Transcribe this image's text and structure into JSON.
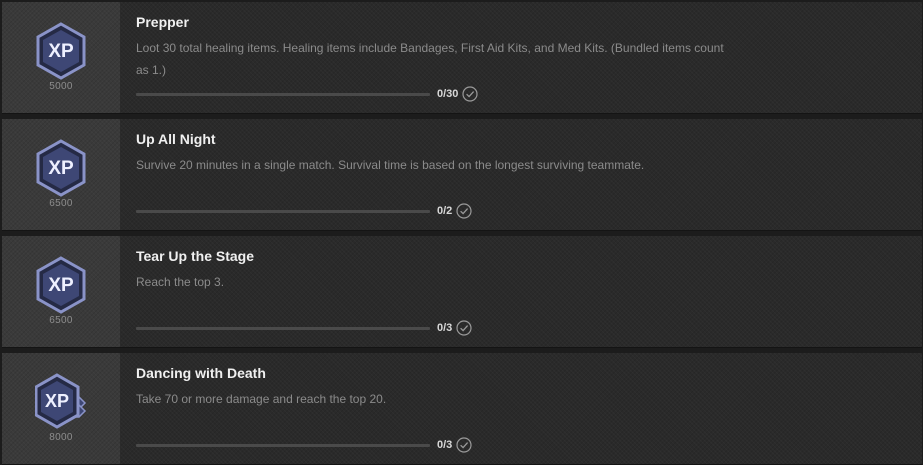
{
  "colors": {
    "badge_fill": "#3e4775",
    "badge_ring": "#8a93c8",
    "badge_text": "#eef0ff",
    "card_bg": "#2a2a2a",
    "reward_bg": "#3a3a3a"
  },
  "challenges": [
    {
      "title": "Prepper",
      "description": "Loot 30 total healing items. Healing items include Bandages, First Aid Kits, and Med Kits. (Bundled items count as 1.)",
      "xp": "5000",
      "progress_text": "0/30",
      "progress_fraction": 0,
      "badge_icon": "xp-badge-icon"
    },
    {
      "title": "Up All Night",
      "description": "Survive 20 minutes in a single match. Survival time is based on the longest surviving teammate.",
      "xp": "6500",
      "progress_text": "0/2",
      "progress_fraction": 0,
      "badge_icon": "xp-badge-icon"
    },
    {
      "title": "Tear Up the Stage",
      "description": "Reach the top 3.",
      "xp": "6500",
      "progress_text": "0/3",
      "progress_fraction": 0,
      "badge_icon": "xp-badge-icon"
    },
    {
      "title": "Dancing with Death",
      "description": "Take 70 or more damage and reach the top 20.",
      "xp": "8000",
      "progress_text": "0/3",
      "progress_fraction": 0,
      "badge_icon": "xp-badge-tiered-icon"
    }
  ],
  "badge_label": "XP"
}
